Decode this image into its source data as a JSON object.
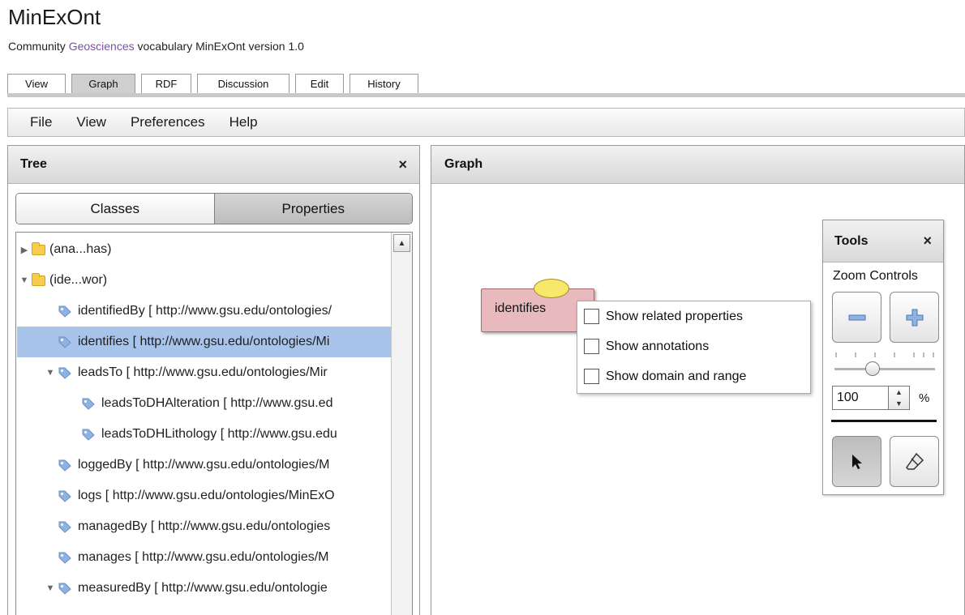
{
  "header": {
    "title": "MinExOnt",
    "subtitle_prefix": "Community ",
    "subtitle_link": "Geosciences",
    "subtitle_suffix": " vocabulary MinExOnt version 1.0"
  },
  "tabs": [
    {
      "label": "View",
      "active": false
    },
    {
      "label": "Graph",
      "active": true
    },
    {
      "label": "RDF",
      "active": false
    },
    {
      "label": "Discussion",
      "active": false
    },
    {
      "label": "Edit",
      "active": false
    },
    {
      "label": "History",
      "active": false
    }
  ],
  "menu": [
    "File",
    "View",
    "Preferences",
    "Help"
  ],
  "tree_panel": {
    "title": "Tree",
    "close": "×",
    "segments": {
      "classes": "Classes",
      "properties": "Properties",
      "selected": "Properties"
    },
    "items": [
      {
        "label": "(ana...has)",
        "type": "folder",
        "expanded": false,
        "selected": false
      },
      {
        "label": "(ide...wor)",
        "type": "folder",
        "expanded": true,
        "selected": false
      },
      {
        "label": "identifiedBy [ http://www.gsu.edu/ontologies/",
        "type": "property",
        "selected": false
      },
      {
        "label": "identifies [ http://www.gsu.edu/ontologies/Mi",
        "type": "property",
        "selected": true
      },
      {
        "label": "leadsTo [ http://www.gsu.edu/ontologies/Mir",
        "type": "property",
        "expanded": true,
        "selected": false
      },
      {
        "label": "leadsToDHAlteration [ http://www.gsu.ed",
        "type": "property",
        "selected": false
      },
      {
        "label": "leadsToDHLithology [ http://www.gsu.edu",
        "type": "property",
        "selected": false
      },
      {
        "label": "loggedBy [ http://www.gsu.edu/ontologies/M",
        "type": "property",
        "selected": false
      },
      {
        "label": "logs [ http://www.gsu.edu/ontologies/MinExO",
        "type": "property",
        "selected": false
      },
      {
        "label": "managedBy [ http://www.gsu.edu/ontologies",
        "type": "property",
        "selected": false
      },
      {
        "label": "manages [ http://www.gsu.edu/ontologies/M",
        "type": "property",
        "selected": false
      },
      {
        "label": "measuredBy [ http://www.gsu.edu/ontologie",
        "type": "property",
        "expanded": true,
        "selected": false
      }
    ]
  },
  "graph_panel": {
    "title": "Graph",
    "node_label": "identifies",
    "context_menu": [
      "Show related properties",
      "Show annotations",
      "Show domain and range"
    ]
  },
  "tools": {
    "title": "Tools",
    "close": "×",
    "zoom_label": "Zoom Controls",
    "zoom_value": "100",
    "zoom_unit": "%",
    "zoom_slider_fraction": 0.38
  },
  "colors": {
    "selection": "#a9c4ea",
    "node_fill": "#e8b9bd",
    "link": "#7b4fa8",
    "folder": "#f5cd4b",
    "tag_icon": "#8fb3e0"
  }
}
